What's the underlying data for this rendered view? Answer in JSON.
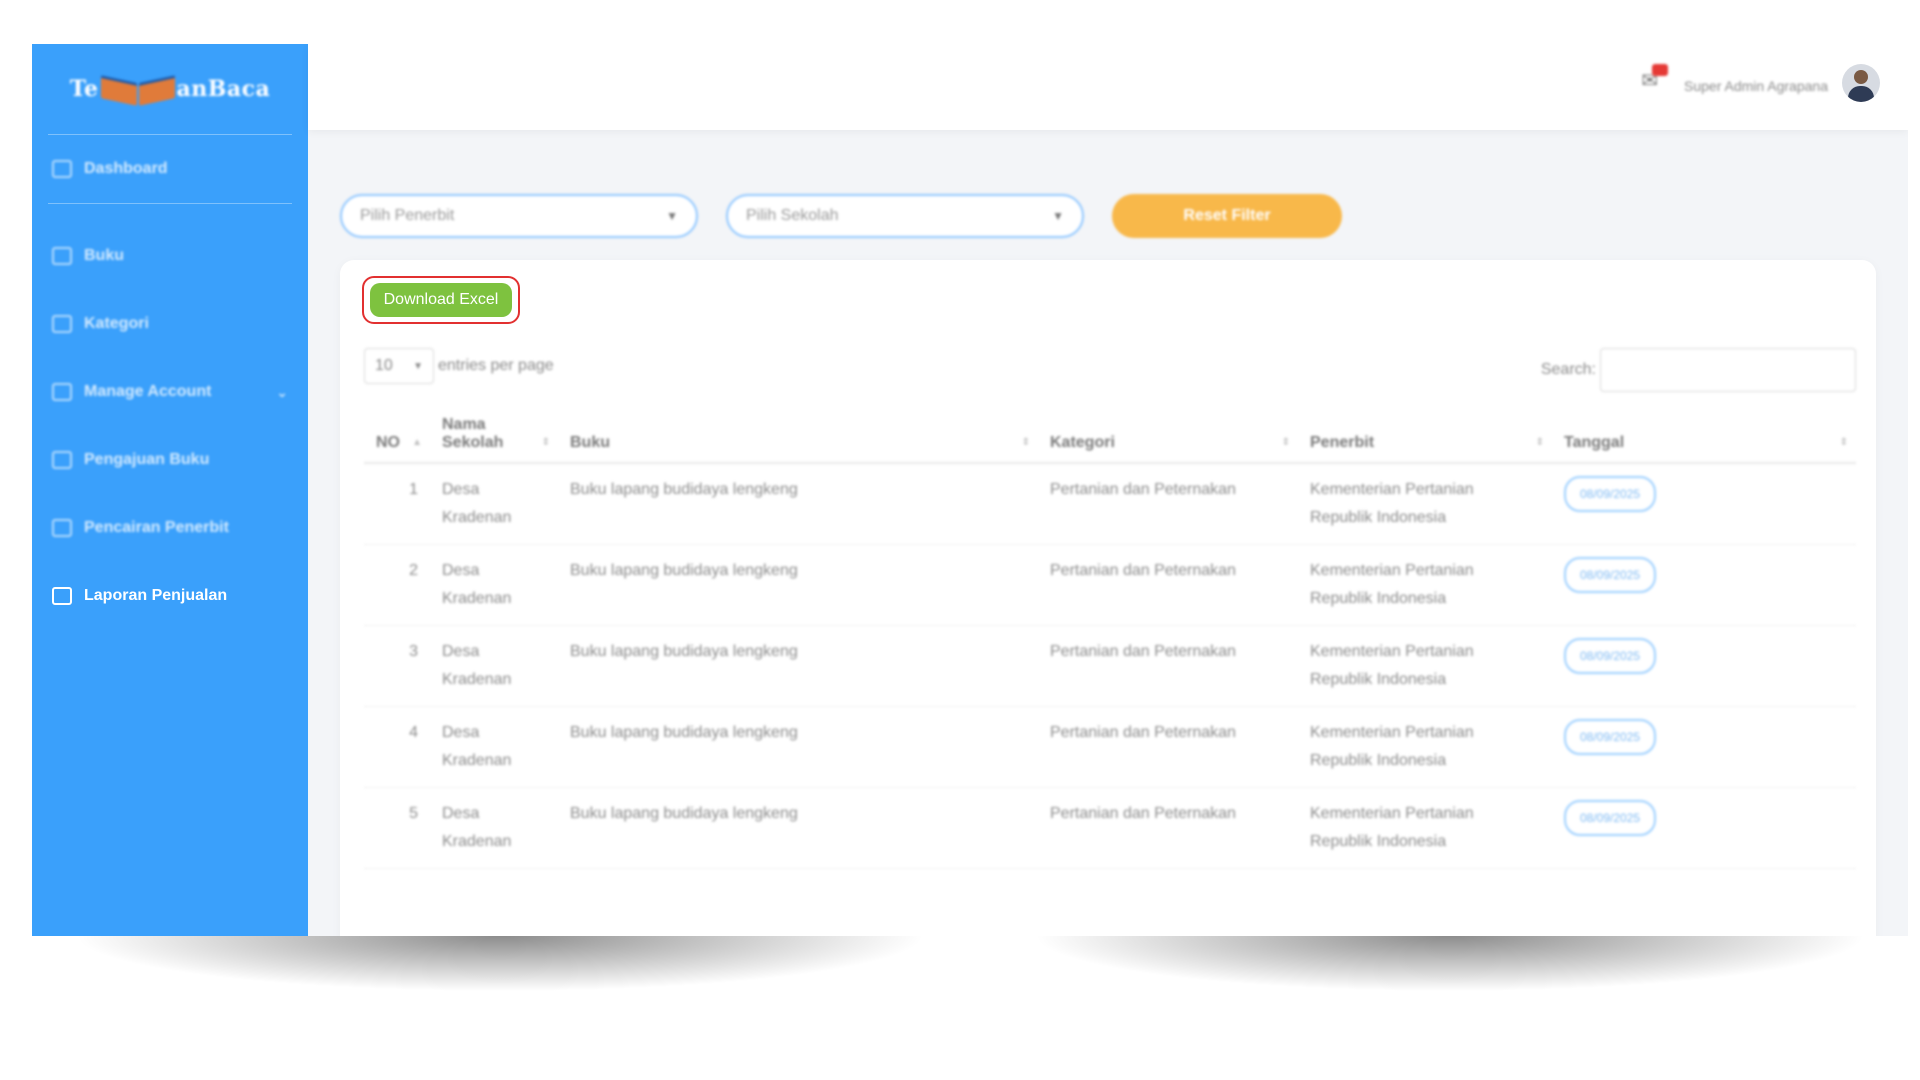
{
  "brand": {
    "left": "Te",
    "right": "anBaca"
  },
  "sidebar": {
    "items": [
      {
        "label": "Dashboard",
        "icon": "home-icon"
      },
      {
        "label": "Buku",
        "icon": "book-icon"
      },
      {
        "label": "Kategori",
        "icon": "list-icon"
      },
      {
        "label": "Manage Account",
        "icon": "users-icon"
      },
      {
        "label": "Pengajuan Buku",
        "icon": "upload-icon"
      },
      {
        "label": "Pencairan Penerbit",
        "icon": "money-icon"
      },
      {
        "label": "Laporan Penjualan",
        "icon": "report-icon"
      }
    ]
  },
  "topbar": {
    "username": "Super Admin Agrapana"
  },
  "filters": {
    "publisher_placeholder": "Pilih Penerbit",
    "school_placeholder": "Pilih Sekolah",
    "reset_label": "Reset Filter"
  },
  "toolbar": {
    "download_label": "Download Excel"
  },
  "table": {
    "entries_value": "10",
    "entries_label": "entries per page",
    "search_label": "Search:",
    "columns": [
      "NO",
      "Nama Sekolah",
      "Buku",
      "Kategori",
      "Penerbit",
      "Tanggal"
    ],
    "rows": [
      {
        "no": "1",
        "school": "Desa Kradenan",
        "book": "Buku lapang budidaya lengkeng",
        "category": "Pertanian dan Peternakan",
        "publisher": "Kementerian Pertanian Republik Indonesia",
        "date": "08/09/2025"
      },
      {
        "no": "2",
        "school": "Desa Kradenan",
        "book": "Buku lapang budidaya lengkeng",
        "category": "Pertanian dan Peternakan",
        "publisher": "Kementerian Pertanian Republik Indonesia",
        "date": "08/09/2025"
      },
      {
        "no": "3",
        "school": "Desa Kradenan",
        "book": "Buku lapang budidaya lengkeng",
        "category": "Pertanian dan Peternakan",
        "publisher": "Kementerian Pertanian Republik Indonesia",
        "date": "08/09/2025"
      },
      {
        "no": "4",
        "school": "Desa Kradenan",
        "book": "Buku lapang budidaya lengkeng",
        "category": "Pertanian dan Peternakan",
        "publisher": "Kementerian Pertanian Republik Indonesia",
        "date": "08/09/2025"
      },
      {
        "no": "5",
        "school": "Desa Kradenan",
        "book": "Buku lapang budidaya lengkeng",
        "category": "Pertanian dan Peternakan",
        "publisher": "Kementerian Pertanian Republik Indonesia",
        "date": "08/09/2025"
      }
    ]
  }
}
